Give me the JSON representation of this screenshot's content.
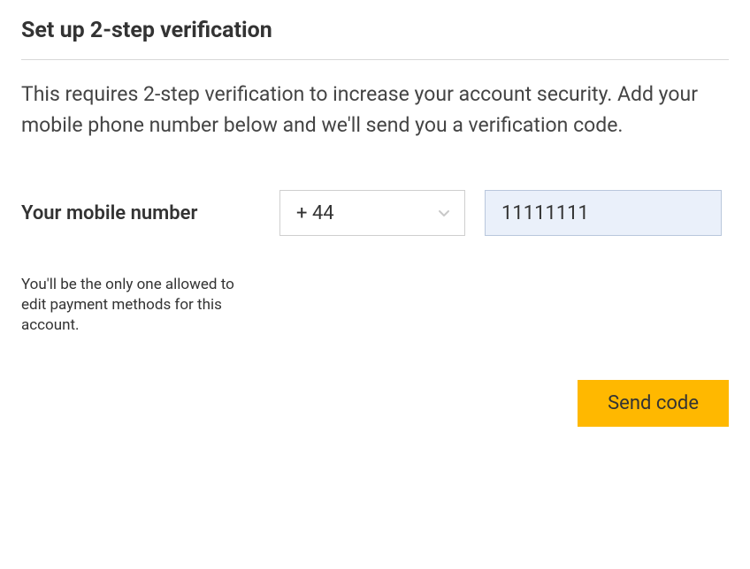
{
  "title": "Set up 2-step verification",
  "description": "This requires 2-step verification to increase your account security. Add your mobile phone number below and we'll send you a verification code.",
  "form": {
    "mobile_label": "Your mobile number",
    "country_code": "+ 44",
    "phone_value": "11111111",
    "helper_text": "You'll be the only one allowed to edit payment methods for this account."
  },
  "actions": {
    "send_label": "Send code"
  },
  "colors": {
    "accent": "#ffb800",
    "input_focus_bg": "#eaf0fa"
  }
}
